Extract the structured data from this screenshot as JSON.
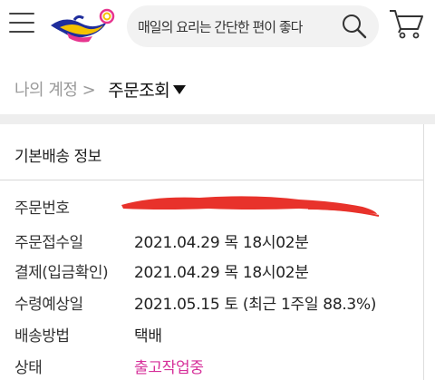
{
  "header": {
    "search_placeholder": "매일의 요리는 간단한 편이 좋다",
    "icons": {
      "menu": "hamburger-menu-icon",
      "logo": "magic-lamp-logo",
      "search": "search-icon",
      "cart": "shopping-cart-icon"
    }
  },
  "breadcrumb": {
    "parent": "나의 계정 >",
    "current": "주문조회"
  },
  "section": {
    "title": "기본배송 정보"
  },
  "rows": [
    {
      "label": "주문번호",
      "value": ""
    },
    {
      "label": "주문접수일",
      "value": "2021.04.29 목 18시02분"
    },
    {
      "label": "결제(입금확인)",
      "value": "2021.04.29 목 18시02분"
    },
    {
      "label": "수령예상일",
      "value": "2021.05.15 토 (최근 1주일 88.3%)"
    },
    {
      "label": "배송방법",
      "value": "택배"
    },
    {
      "label": "상태",
      "value": "출고작업중"
    }
  ],
  "colors": {
    "status": "#d6309a",
    "redaction": "#e8322b",
    "logo_blue": "#1f2d9c",
    "logo_yellow": "#f5c100",
    "logo_pink": "#e7358f"
  }
}
